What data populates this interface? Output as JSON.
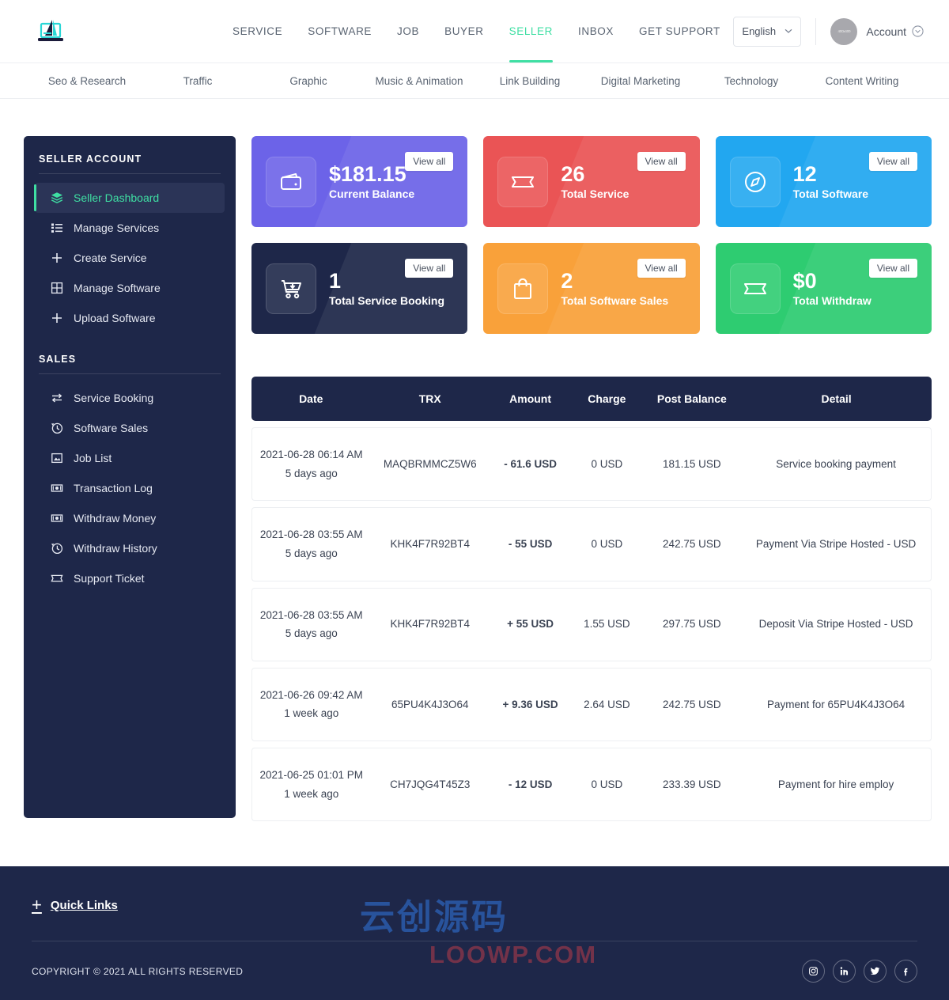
{
  "header": {
    "logo_name": "laptop-sail-logo",
    "nav": [
      {
        "label": "SERVICE",
        "active": false
      },
      {
        "label": "SOFTWARE",
        "active": false
      },
      {
        "label": "JOB",
        "active": false
      },
      {
        "label": "BUYER",
        "active": false
      },
      {
        "label": "SELLER",
        "active": true
      },
      {
        "label": "INBOX",
        "active": false
      },
      {
        "label": "GET SUPPORT",
        "active": false
      }
    ],
    "language": "English",
    "avatar_text": "400x400",
    "account_label": "Account"
  },
  "categories": [
    "Seo & Research",
    "Traffic",
    "Graphic",
    "Music & Animation",
    "Link Building",
    "Digital Marketing",
    "Technology",
    "Content Writing"
  ],
  "sidebar": {
    "section1_title": "SELLER ACCOUNT",
    "section1_items": [
      {
        "label": "Seller Dashboard",
        "icon": "layers-icon",
        "active": true
      },
      {
        "label": "Manage Services",
        "icon": "list-icon",
        "active": false
      },
      {
        "label": "Create Service",
        "icon": "plus-icon",
        "active": false
      },
      {
        "label": "Manage Software",
        "icon": "grid-icon",
        "active": false
      },
      {
        "label": "Upload Software",
        "icon": "plus-icon",
        "active": false
      }
    ],
    "section2_title": "SALES",
    "section2_items": [
      {
        "label": "Service Booking",
        "icon": "exchange-icon",
        "active": false
      },
      {
        "label": "Software Sales",
        "icon": "history-icon",
        "active": false
      },
      {
        "label": "Job List",
        "icon": "image-icon",
        "active": false
      },
      {
        "label": "Transaction Log",
        "icon": "money-icon",
        "active": false
      },
      {
        "label": "Withdraw Money",
        "icon": "money-icon",
        "active": false
      },
      {
        "label": "Withdraw History",
        "icon": "history-icon",
        "active": false
      },
      {
        "label": "Support Ticket",
        "icon": "ticket-icon",
        "active": false
      }
    ]
  },
  "stat_cards": [
    {
      "value": "$181.15",
      "label": "Current Balance",
      "action": "View all",
      "icon": "wallet-icon",
      "color": "#6c63e8",
      "theme": "c-purple"
    },
    {
      "value": "26",
      "label": "Total Service",
      "action": "View all",
      "icon": "ticket-icon",
      "color": "#ea5455",
      "theme": "c-red"
    },
    {
      "value": "12",
      "label": "Total Software",
      "action": "View all",
      "icon": "compass-icon",
      "color": "#22a7f0",
      "theme": "c-blue"
    },
    {
      "value": "1",
      "label": "Total Service Booking",
      "action": "View all",
      "icon": "cart-download-icon",
      "color": "#1e2749",
      "theme": "c-dark"
    },
    {
      "value": "2",
      "label": "Total Software Sales",
      "action": "View all",
      "icon": "bag-icon",
      "color": "#f9a13a",
      "theme": "c-orange"
    },
    {
      "value": "$0",
      "label": "Total Withdraw",
      "action": "View all",
      "icon": "ticket-icon",
      "color": "#2ecc71",
      "theme": "c-green"
    }
  ],
  "table": {
    "columns": [
      "Date",
      "TRX",
      "Amount",
      "Charge",
      "Post Balance",
      "Detail"
    ],
    "rows": [
      {
        "date": "2021-06-28 06:14 AM",
        "ago": "5 days ago",
        "trx": "MAQBRMMCZ5W6",
        "amount": "- 61.6 USD",
        "amount_sign": "neg",
        "charge": "0 USD",
        "post_balance": "181.15 USD",
        "detail": "Service booking payment"
      },
      {
        "date": "2021-06-28 03:55 AM",
        "ago": "5 days ago",
        "trx": "KHK4F7R92BT4",
        "amount": "- 55 USD",
        "amount_sign": "neg",
        "charge": "0 USD",
        "post_balance": "242.75 USD",
        "detail": "Payment Via Stripe Hosted - USD"
      },
      {
        "date": "2021-06-28 03:55 AM",
        "ago": "5 days ago",
        "trx": "KHK4F7R92BT4",
        "amount": "+ 55 USD",
        "amount_sign": "pos",
        "charge": "1.55 USD",
        "post_balance": "297.75 USD",
        "detail": "Deposit Via Stripe Hosted - USD"
      },
      {
        "date": "2021-06-26 09:42 AM",
        "ago": "1 week ago",
        "trx": "65PU4K4J3O64",
        "amount": "+ 9.36 USD",
        "amount_sign": "pos",
        "charge": "2.64 USD",
        "post_balance": "242.75 USD",
        "detail": "Payment for 65PU4K4J3O64"
      },
      {
        "date": "2021-06-25 01:01 PM",
        "ago": "1 week ago",
        "trx": "CH7JQG4T45Z3",
        "amount": "- 12 USD",
        "amount_sign": "neg",
        "charge": "0 USD",
        "post_balance": "233.39 USD",
        "detail": "Payment for hire employ"
      }
    ]
  },
  "footer": {
    "quick_links": "Quick Links",
    "copyright": "COPYRIGHT © 2021 ALL RIGHTS RESERVED",
    "socials": [
      "instagram-icon",
      "linkedin-icon",
      "twitter-icon",
      "facebook-icon"
    ],
    "watermark_cn": "云创源码",
    "watermark_en": "LOOWP.COM"
  },
  "colors": {
    "accent_green": "#3fdfa3",
    "dark_navy": "#1e2749",
    "negative": "#ef3b3b",
    "positive": "#16c65a"
  }
}
